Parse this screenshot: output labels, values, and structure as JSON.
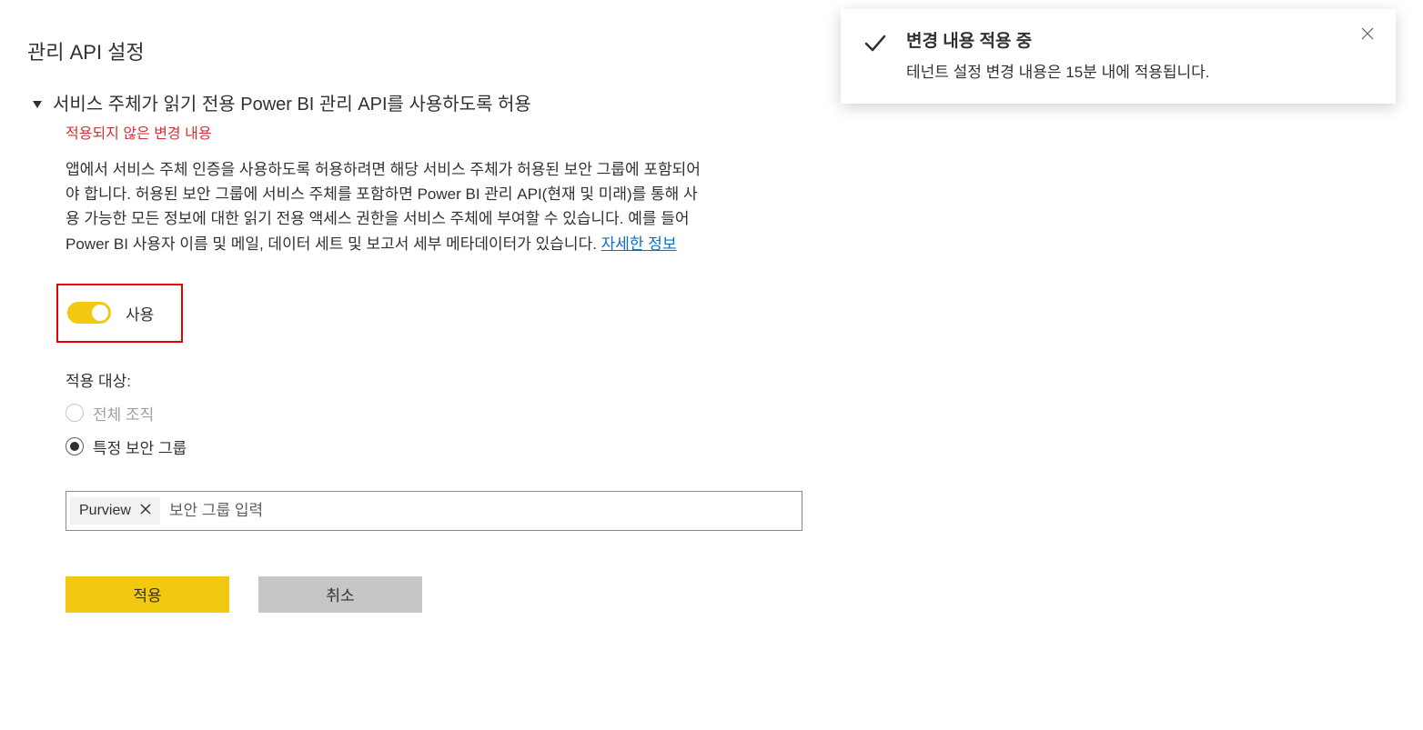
{
  "section": {
    "title": "관리 API 설정"
  },
  "setting": {
    "title": "서비스 주체가 읽기 전용 Power BI 관리 API를 사용하도록 허용",
    "unsaved_label": "적용되지 않은 변경 내용",
    "description_pre": "앱에서 서비스 주체 인증을 사용하도록 허용하려면 해당 서비스 주체가 허용된 보안 그룹에 포함되어야 합니다. 허용된 보안 그룹에 서비스 주체를 포함하면 Power BI 관리 API(현재 및 미래)를 통해 사용 가능한 모든 정보에 대한 읽기 전용 액세스 권한을 서비스 주체에 부여할 수 있습니다. 예를 들어 Power BI 사용자 이름 및 메일, 데이터 세트 및 보고서 세부 메타데이터가 있습니다. ",
    "learn_more": "자세한 정보",
    "toggle_label": "사용",
    "apply_to_label": "적용 대상:",
    "radio_entire_org": "전체 조직",
    "radio_specific_groups": "특정 보안 그룹",
    "security_group_chip": "Purview",
    "security_group_placeholder": "보안 그룹 입력",
    "apply_button": "적용",
    "cancel_button": "취소"
  },
  "toast": {
    "title": "변경 내용 적용 중",
    "message": "테넌트 설정 변경 내용은 15분 내에 적용됩니다."
  }
}
